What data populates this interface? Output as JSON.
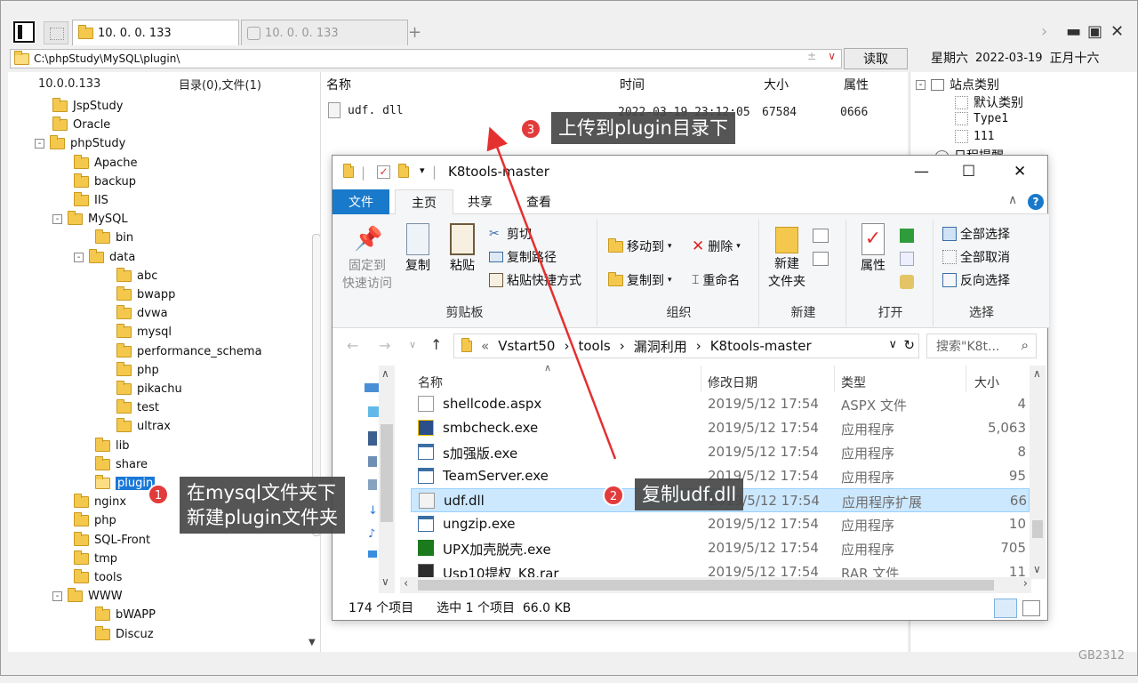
{
  "manager": {
    "tabs": [
      {
        "label": "10. 0. 0. 133",
        "active": true
      },
      {
        "label": "10. 0. 0. 133",
        "active": false
      }
    ],
    "address_path": "C:\\phpStudy\\MySQL\\plugin\\",
    "read_button": "读取",
    "date": {
      "weekday": "星期六",
      "date": "2022-03-19",
      "lunar": "正月十六"
    },
    "tree_header": {
      "host": "10.0.0.133",
      "summary": "目录(0),文件(1)"
    },
    "tree": [
      {
        "label": "JspStudy",
        "depth": 2,
        "expand": ""
      },
      {
        "label": "Oracle",
        "depth": 2,
        "expand": ""
      },
      {
        "label": "phpStudy",
        "depth": 1,
        "expand": "-"
      },
      {
        "label": "Apache",
        "depth": 3,
        "expand": ""
      },
      {
        "label": "backup",
        "depth": 3,
        "expand": ""
      },
      {
        "label": "IIS",
        "depth": 3,
        "expand": ""
      },
      {
        "label": "MySQL",
        "depth": 2,
        "expand": "-"
      },
      {
        "label": "bin",
        "depth": 4,
        "expand": ""
      },
      {
        "label": "data",
        "depth": 3,
        "expand": "-"
      },
      {
        "label": "abc",
        "depth": 5,
        "expand": ""
      },
      {
        "label": "bwapp",
        "depth": 5,
        "expand": ""
      },
      {
        "label": "dvwa",
        "depth": 5,
        "expand": ""
      },
      {
        "label": "mysql",
        "depth": 5,
        "expand": ""
      },
      {
        "label": "performance_schema",
        "depth": 5,
        "expand": ""
      },
      {
        "label": "php",
        "depth": 5,
        "expand": ""
      },
      {
        "label": "pikachu",
        "depth": 5,
        "expand": ""
      },
      {
        "label": "test",
        "depth": 5,
        "expand": ""
      },
      {
        "label": "ultrax",
        "depth": 5,
        "expand": ""
      },
      {
        "label": "lib",
        "depth": 4,
        "expand": ""
      },
      {
        "label": "share",
        "depth": 4,
        "expand": ""
      },
      {
        "label": "plugin",
        "depth": 4,
        "expand": "",
        "selected": true
      },
      {
        "label": "nginx",
        "depth": 3,
        "expand": ""
      },
      {
        "label": "php",
        "depth": 3,
        "expand": ""
      },
      {
        "label": "SQL-Front",
        "depth": 3,
        "expand": ""
      },
      {
        "label": "tmp",
        "depth": 3,
        "expand": ""
      },
      {
        "label": "tools",
        "depth": 3,
        "expand": ""
      },
      {
        "label": "WWW",
        "depth": 2,
        "expand": "-"
      },
      {
        "label": "bWAPP",
        "depth": 4,
        "expand": ""
      },
      {
        "label": "Discuz",
        "depth": 4,
        "expand": ""
      }
    ],
    "file_columns": {
      "name": "名称",
      "time": "时间",
      "size": "大小",
      "attr": "属性"
    },
    "files": [
      {
        "name": "udf. dll",
        "time": "2022-03-19 23:12:05",
        "size": "67584",
        "attr": "0666"
      }
    ],
    "side_panel": {
      "site_category": "站点类别",
      "items": [
        "默认类别",
        "Type1",
        "111"
      ],
      "reminder": "日程提醒"
    },
    "footer_tag": "GB2312"
  },
  "explorer": {
    "title": "K8tools-master",
    "ribbon_tabs": [
      "文件",
      "主页",
      "共享",
      "查看"
    ],
    "groups": {
      "clipboard": {
        "name": "剪贴板",
        "pin": "固定到\n快速访问",
        "copy": "复制",
        "paste": "粘贴",
        "cut": "剪切",
        "copy_path": "复制路径",
        "paste_shortcut": "粘贴快捷方式"
      },
      "organize": {
        "name": "组织",
        "move_to": "移动到",
        "copy_to": "复制到",
        "delete": "删除",
        "rename": "重命名"
      },
      "new": {
        "name": "新建",
        "new_folder": "新建\n文件夹"
      },
      "open": {
        "name": "打开",
        "properties": "属性"
      },
      "select": {
        "name": "选择",
        "select_all": "全部选择",
        "select_none": "全部取消",
        "invert": "反向选择"
      }
    },
    "breadcrumb": [
      "Vstart50",
      "tools",
      "漏洞利用",
      "K8tools-master"
    ],
    "search_placeholder": "搜索\"K8t...",
    "columns": {
      "name": "名称",
      "date": "修改日期",
      "type": "类型",
      "size": "大小"
    },
    "rows": [
      {
        "name": "shellcode.aspx",
        "date": "2019/5/12 17:54",
        "type": "ASPX 文件",
        "size": "4",
        "icon": "aspx-file-icon"
      },
      {
        "name": "smbcheck.exe",
        "date": "2019/5/12 17:54",
        "type": "应用程序",
        "size": "5,063",
        "icon": "exe-icon"
      },
      {
        "name": "s加强版.exe",
        "date": "2019/5/12 17:54",
        "type": "应用程序",
        "size": "8",
        "icon": "exe-window-icon"
      },
      {
        "name": "TeamServer.exe",
        "date": "2019/5/12 17:54",
        "type": "应用程序",
        "size": "95",
        "icon": "exe-window-icon"
      },
      {
        "name": "udf.dll",
        "date": "2019/5/12 17:54",
        "type": "应用程序扩展",
        "size": "66",
        "icon": "dll-icon",
        "selected": true
      },
      {
        "name": "ungzip.exe",
        "date": "2019/5/12 17:54",
        "type": "应用程序",
        "size": "10",
        "icon": "exe-window-icon"
      },
      {
        "name": "UPX加壳脱壳.exe",
        "date": "2019/5/12 17:54",
        "type": "应用程序",
        "size": "705",
        "icon": "k8-icon"
      },
      {
        "name": "Usp10提权_K8.rar",
        "date": "2019/5/12 17:54",
        "type": "RAR 文件",
        "size": "11",
        "icon": "rar-icon"
      }
    ],
    "status": {
      "count": "174 个项目",
      "selected": "选中 1 个项目  66.0 KB"
    }
  },
  "annotations": [
    {
      "num": "1",
      "text": "在mysql文件夹下\n新建plugin文件夹"
    },
    {
      "num": "2",
      "text": "复制udf.dll"
    },
    {
      "num": "3",
      "text": "上传到plugin目录下"
    }
  ],
  "colors": {
    "accent": "#1979ca",
    "selection": "#cce8ff",
    "callout": "#464646",
    "badge": "#e23b3b",
    "arrow": "#e53030"
  }
}
